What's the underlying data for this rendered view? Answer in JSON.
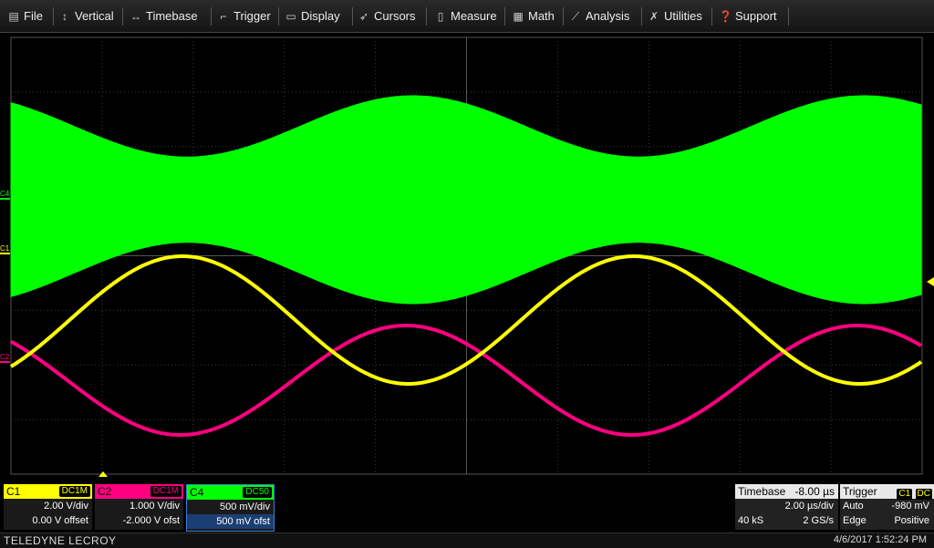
{
  "menu": [
    {
      "label": "File",
      "icon": "save-icon"
    },
    {
      "label": "Vertical",
      "icon": "vertical-arrows-icon"
    },
    {
      "label": "Timebase",
      "icon": "horizontal-arrows-icon"
    },
    {
      "label": "Trigger",
      "icon": "trigger-icon"
    },
    {
      "label": "Display",
      "icon": "display-icon"
    },
    {
      "label": "Cursors",
      "icon": "cursor-icon"
    },
    {
      "label": "Measure",
      "icon": "ruler-icon"
    },
    {
      "label": "Math",
      "icon": "calculator-icon"
    },
    {
      "label": "Analysis",
      "icon": "chart-icon"
    },
    {
      "label": "Utilities",
      "icon": "wrench-icon"
    },
    {
      "label": "Support",
      "icon": "help-icon"
    }
  ],
  "channel_markers": {
    "c4": "C4",
    "c1": "C1",
    "c2": "C2"
  },
  "colors": {
    "c1": "#ffff00",
    "c2": "#ff0080",
    "c4": "#00ff00",
    "grid": "#3a3a3a",
    "trigger": "#ffff00"
  },
  "channels": [
    {
      "name": "C1",
      "coupling": "DC1M",
      "vdiv": "2.00 V/div",
      "offset": "0.00 V offset",
      "color": "#ffff00"
    },
    {
      "name": "C2",
      "coupling": "DC1M",
      "vdiv": "1.000 V/div",
      "offset": "-2.000 V ofst",
      "color": "#ff0080"
    },
    {
      "name": "C4",
      "coupling": "DC50",
      "vdiv": "500 mV/div",
      "offset": "500 mV ofst",
      "color": "#00ff00"
    }
  ],
  "timebase": {
    "label": "Timebase",
    "delay": "-8.00 µs",
    "tdiv": "2.00 µs/div",
    "samples": "40 kS",
    "rate": "2 GS/s"
  },
  "trigger": {
    "label": "Trigger",
    "source": "C1",
    "coupling": "DC",
    "mode": "Auto",
    "level": "-980 mV",
    "type": "Edge",
    "slope": "Positive"
  },
  "status": {
    "brand": "TELEDYNE LECROY",
    "datetime": "4/6/2017 1:52:24 PM"
  }
}
